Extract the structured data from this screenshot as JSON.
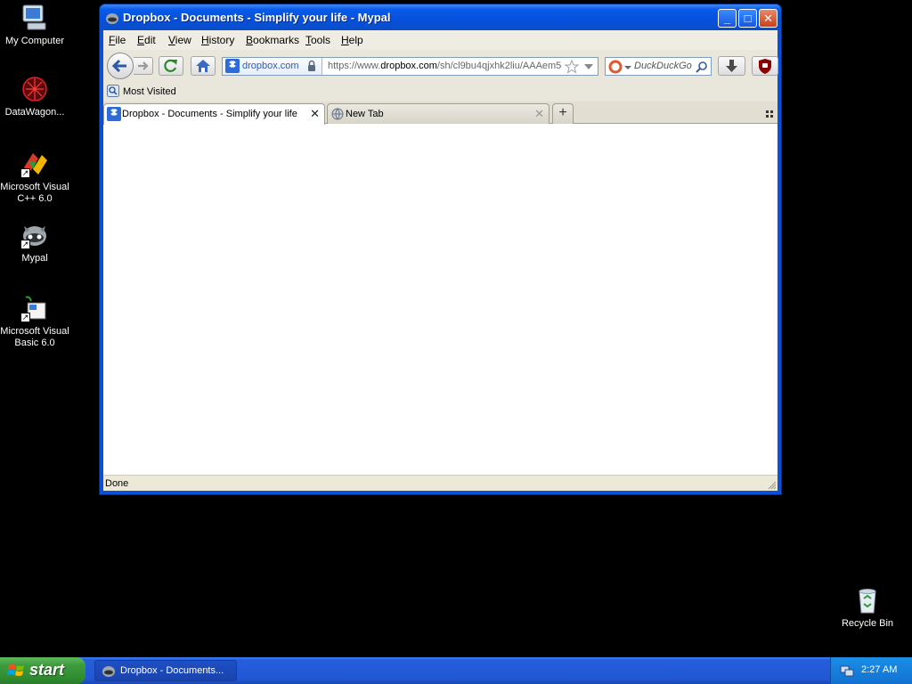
{
  "desktop": {
    "icons": [
      {
        "label": "My Computer"
      },
      {
        "label": "DataWagon..."
      },
      {
        "label": "Microsoft Visual C++ 6.0"
      },
      {
        "label": "Mypal"
      },
      {
        "label": "Microsoft Visual Basic 6.0"
      },
      {
        "label": "Recycle Bin"
      }
    ]
  },
  "window": {
    "title": "Dropbox - Documents - Simplify your life - Mypal",
    "controls": {
      "minimize": "_",
      "maximize": "□",
      "close": "✕"
    }
  },
  "menubar": {
    "items": [
      {
        "label": "File",
        "accel": "F",
        "rest": "ile"
      },
      {
        "label": "Edit",
        "accel": "E",
        "rest": "dit"
      },
      {
        "label": "View",
        "accel": "V",
        "rest": "iew"
      },
      {
        "label": "History",
        "accel": "H",
        "rest": "istory"
      },
      {
        "label": "Bookmarks",
        "accel": "B",
        "rest": "ookmarks"
      },
      {
        "label": "Tools",
        "accel": "T",
        "rest": "ools"
      },
      {
        "label": "Help",
        "accel": "H",
        "rest": "elp"
      }
    ]
  },
  "navbar": {
    "identity_host": "dropbox.com",
    "url_prefix": "https://www.",
    "url_domain": "dropbox.com",
    "url_path": "/sh/cl9bu4qjxhk2liu/AAAem5",
    "search_placeholder": "DuckDuckGo"
  },
  "bookmarks_toolbar": {
    "items": [
      {
        "label": "Most Visited"
      }
    ]
  },
  "tabs": [
    {
      "label": "Dropbox - Documents - Simplify your life",
      "close": "✕",
      "active": true
    },
    {
      "label": "New Tab",
      "close": "✕",
      "active": false
    }
  ],
  "new_tab": "+",
  "statusbar": {
    "text": "Done"
  },
  "taskbar": {
    "start_label": "start",
    "task_label": "Dropbox - Documents...",
    "clock": "2:27 AM"
  },
  "colors": {
    "title_blue": "#0a50d8",
    "taskbar_blue": "#245edb",
    "start_green": "#3d9b3d",
    "dropbox_blue": "#2d5bb7"
  }
}
